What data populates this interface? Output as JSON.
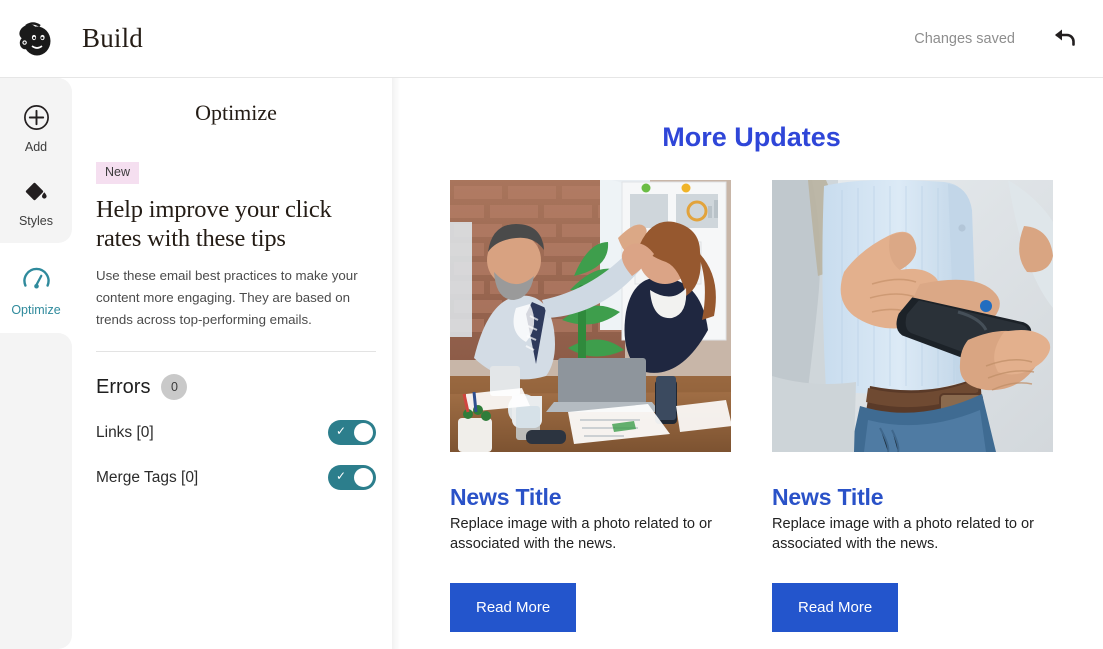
{
  "header": {
    "logo_icon": "mailchimp-monkey-logo",
    "title": "Build",
    "save_status": "Changes saved",
    "undo_icon": "undo-arrow-icon"
  },
  "sidebar": {
    "items": [
      {
        "label": "Add",
        "icon": "plus-circle-icon",
        "active": false
      },
      {
        "label": "Styles",
        "icon": "paint-drop-icon",
        "active": false
      },
      {
        "label": "Optimize",
        "icon": "speedometer-gauge-icon",
        "active": true
      }
    ],
    "active_color": "#2f8a9c"
  },
  "panel": {
    "title": "Optimize",
    "badge": "New",
    "badge_color": "#f5dff0",
    "heading": "Help improve your click rates with these tips",
    "body": "Use these email best practices to make your content more engaging. They are based on trends across top-performing emails.",
    "errors": {
      "label": "Errors",
      "count": "0",
      "checks": [
        {
          "label": "Links [0]",
          "enabled": true
        },
        {
          "label": "Merge Tags [0]",
          "enabled": true
        }
      ]
    },
    "toggle_color": "#2c7e8c"
  },
  "email": {
    "heading": "More Updates",
    "heading_color": "#2f46d8",
    "cards": [
      {
        "image_alt": "two-colleagues-high-five-at-desk-photo",
        "title": "News Title",
        "text": "Replace image with a photo related to or associated with the news.",
        "button": "Read More"
      },
      {
        "image_alt": "man-handing-over-smartphone-photo",
        "title": "News Title",
        "text": "Replace image with a photo related to or associated with the news.",
        "button": "Read More"
      }
    ],
    "button_color": "#2355cc",
    "title_color": "#2a52c8"
  }
}
